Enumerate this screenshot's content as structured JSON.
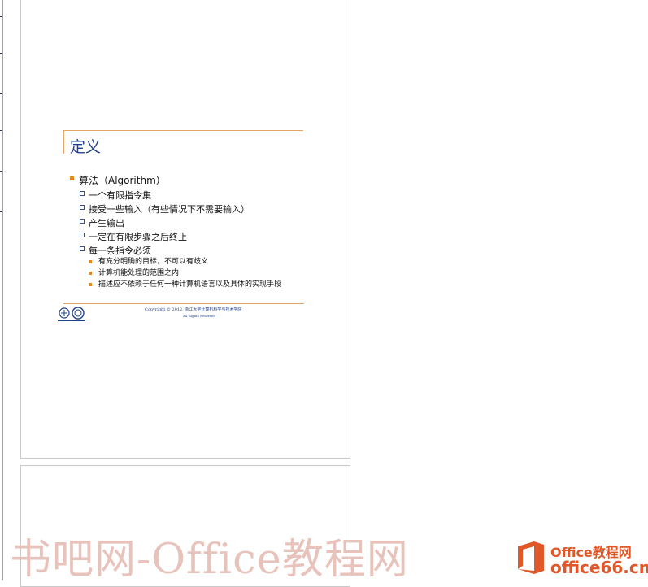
{
  "slide": {
    "title": "定义",
    "bullets": [
      {
        "level": 1,
        "text": "算法（Algorithm）"
      },
      {
        "level": 2,
        "text": "一个有限指令集"
      },
      {
        "level": 2,
        "text": "接受一些输入（有些情况下不需要输入）"
      },
      {
        "level": 2,
        "text": "产生输出"
      },
      {
        "level": 2,
        "text": "一定在有限步骤之后终止"
      },
      {
        "level": 2,
        "text": "每一条指令必须"
      },
      {
        "level": 3,
        "text": "有充分明确的目标，不可以有歧义"
      },
      {
        "level": 3,
        "text": "计算机能处理的范围之内"
      },
      {
        "level": 3,
        "text": "描述应不依赖于任何一种计算机语言以及具体的实现手段"
      }
    ],
    "footer": {
      "copyright": "Copyright © 2012, 浙江大学计算机科学与技术学院",
      "copyright_sub": "All Rights Reserved"
    }
  },
  "watermark": {
    "text": "书吧网-Office教程网",
    "brand_line1": "Office教程网",
    "brand_line2": "office66.cn"
  },
  "colors": {
    "title": "#1f3f8f",
    "accent": "#e08a1e",
    "frame": "#e5a467",
    "brand": "#e0582a"
  }
}
